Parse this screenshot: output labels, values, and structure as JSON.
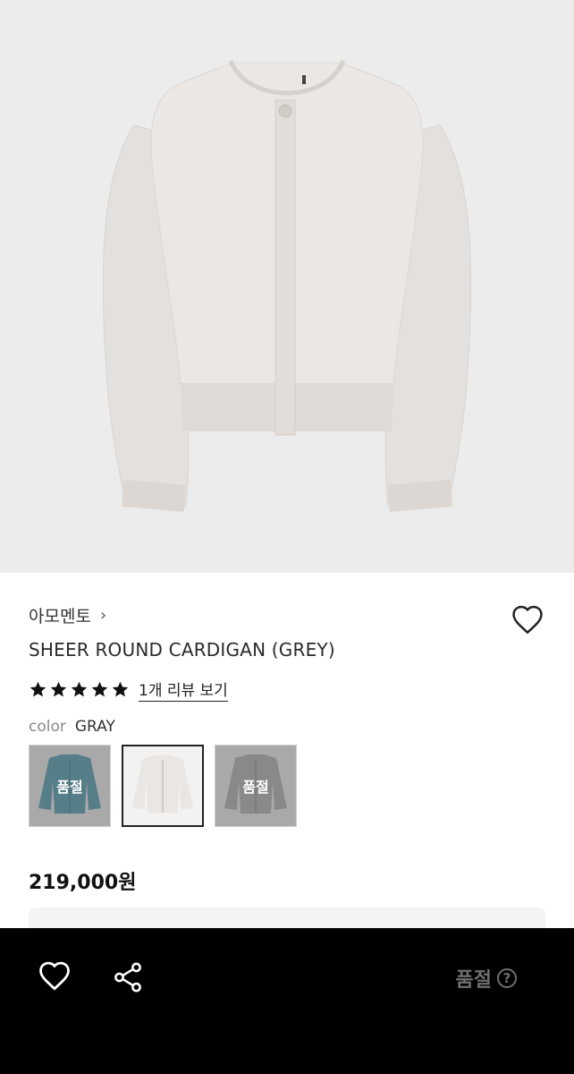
{
  "product": {
    "brand": "아모멘토",
    "brand_chevron": "›",
    "name": "SHEER ROUND CARDIGAN (GREY)",
    "rating": 5,
    "review_link": "1개 리뷰 보기",
    "color_label": "color",
    "color_value": "GRAY",
    "price": "219,000원"
  },
  "swatches": [
    {
      "color": "#5aa4b6",
      "soldout": true,
      "soldout_label": "품절",
      "selected": false
    },
    {
      "color": "#eae6e3",
      "soldout": false,
      "soldout_label": "",
      "selected": true
    },
    {
      "color": "#b9b9b9",
      "soldout": true,
      "soldout_label": "품절",
      "selected": false
    }
  ],
  "bottom_bar": {
    "status": "품절",
    "help_icon": "?"
  },
  "colors": {
    "hero_bg": "#ececec",
    "garment": "#e7e3e0",
    "bottom_bar_bg": "#000000",
    "status_text": "#6f6f6f"
  }
}
